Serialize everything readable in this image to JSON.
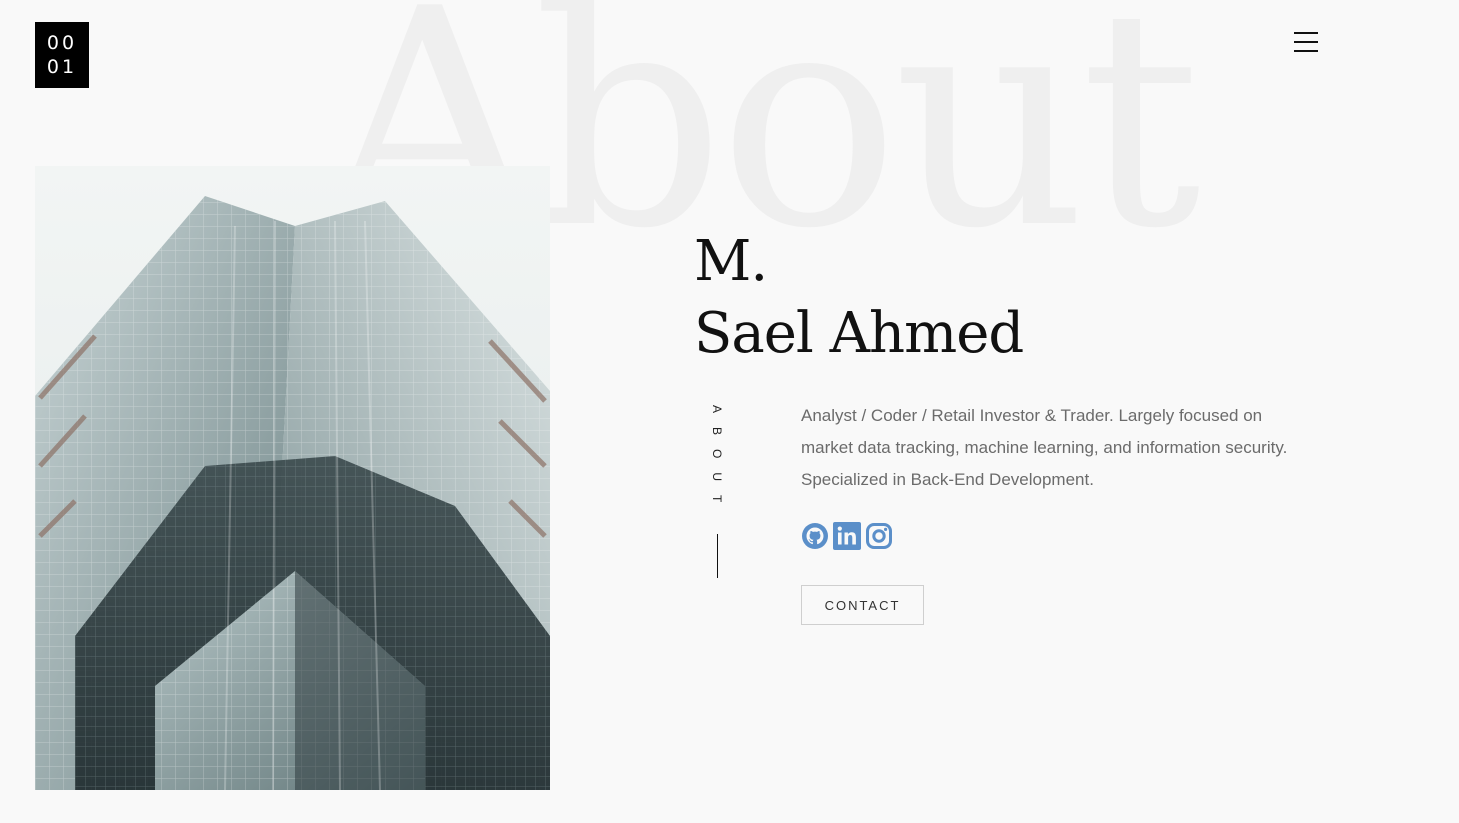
{
  "logo": {
    "line1": "00",
    "line2": "01"
  },
  "background_word": "About",
  "hero": {
    "name_line1": "M.",
    "name_line2": "Sael Ahmed"
  },
  "side_label": "ABOUT",
  "bio": "Analyst / Coder / Retail Investor & Trader. Largely focused on market data tracking, machine learning, and information security. Specialized in Back-End Development.",
  "socials": [
    {
      "icon": "github-icon"
    },
    {
      "icon": "linkedin-icon"
    },
    {
      "icon": "instagram-icon"
    }
  ],
  "contact_label": "CONTACT",
  "colors": {
    "background": "#f9f9f9",
    "text_dark": "#111111",
    "text_body": "#6b6b6b",
    "social_accent": "#5b8fc9",
    "background_word": "#efefef"
  }
}
